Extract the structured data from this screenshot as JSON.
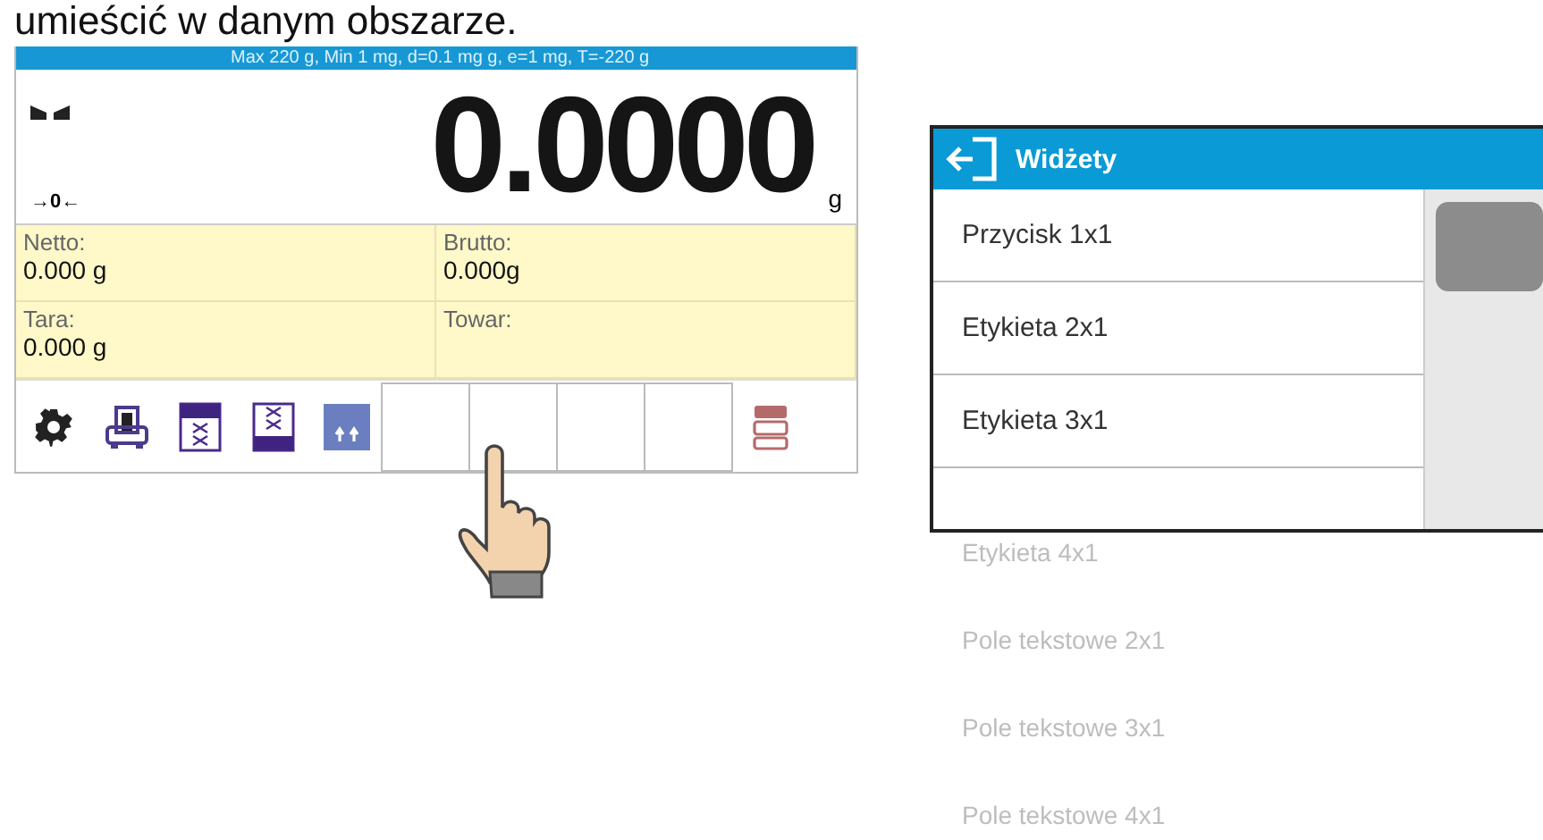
{
  "caption": "umieścić w danym obszarze.",
  "scale_screen": {
    "header": "Max 220 g, Min 1 mg, d=0.1 mg g, e=1 mg, T=-220 g",
    "zero_indicator": "→0←",
    "reading": "0.0000",
    "unit": "g",
    "info_fields": [
      {
        "label": "Netto:",
        "value": "0.000 g"
      },
      {
        "label": "Brutto:",
        "value": "0.000g"
      },
      {
        "label": "Tara:",
        "value": "0.000 g"
      },
      {
        "label": "Towar:"
      }
    ],
    "toolbar": [
      {
        "kind": "gear"
      },
      {
        "kind": "scale"
      },
      {
        "kind": "tile-top"
      },
      {
        "kind": "tile-bottom"
      },
      {
        "kind": "arrows"
      },
      {
        "kind": "empty"
      },
      {
        "kind": "empty"
      },
      {
        "kind": "empty"
      },
      {
        "kind": "empty"
      },
      {
        "kind": "database"
      }
    ]
  },
  "widget_menu": {
    "title": "Widżety",
    "items": [
      {
        "label": "Przycisk 1x1",
        "kind": "row"
      },
      {
        "label": "Etykieta 2x1",
        "kind": "row"
      },
      {
        "label": "Etykieta 3x1",
        "kind": "row"
      },
      {
        "label": "Etykieta 4x1",
        "kind": "faded"
      },
      {
        "label": "Pole tekstowe 2x1",
        "kind": "faded"
      },
      {
        "label": "Pole tekstowe 3x1",
        "kind": "faded"
      },
      {
        "label": "Pole tekstowe 4x1",
        "kind": "faded"
      }
    ]
  }
}
